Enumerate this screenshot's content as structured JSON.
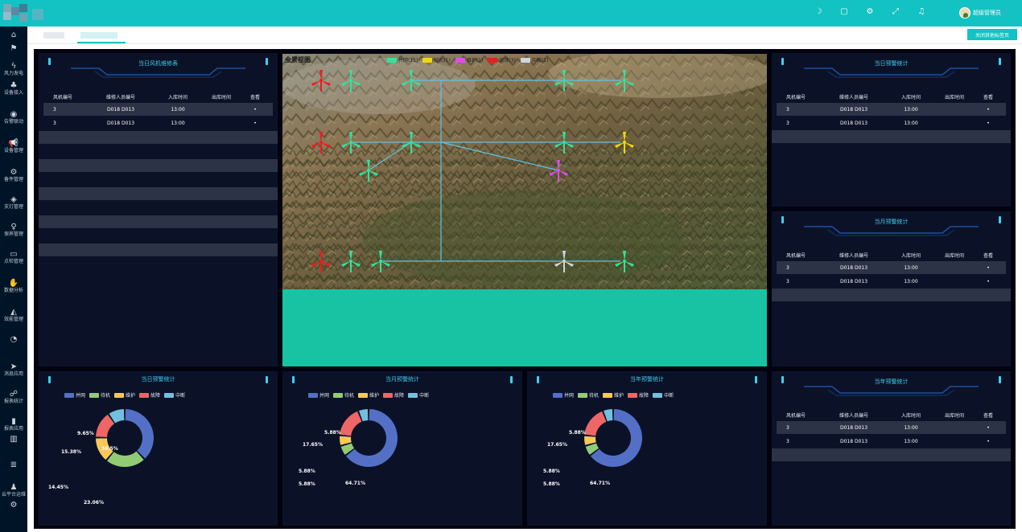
{
  "header": {
    "user_name": "超级管理员",
    "icons": [
      "moon-icon",
      "document-icon",
      "gear-icon",
      "expand-icon",
      "bell-icon"
    ]
  },
  "sidebar": {
    "items": [
      {
        "label": "",
        "icon": "home-icon"
      },
      {
        "label": "",
        "icon": "flag-icon"
      },
      {
        "label": "风力发电",
        "icon": "lightning-icon"
      },
      {
        "label": "设备接入",
        "icon": "tree-icon"
      },
      {
        "label": "告警联动",
        "icon": "chrome-icon"
      },
      {
        "label": "设备管理",
        "icon": "megaphone-icon"
      },
      {
        "label": "备件管理",
        "icon": "settings-icon"
      },
      {
        "label": "支灯管理",
        "icon": "cube-icon"
      },
      {
        "label": "保养管理",
        "icon": "bulb-icon"
      },
      {
        "label": "点检管理",
        "icon": "briefcase-icon"
      },
      {
        "label": "数据分析",
        "icon": "hand-icon"
      },
      {
        "label": "效能管理",
        "icon": "area-chart-icon"
      },
      {
        "label": "",
        "icon": "gauge-icon"
      },
      {
        "label": "消息应用",
        "icon": "send-icon"
      },
      {
        "label": "报表统计",
        "icon": "cluster-icon"
      },
      {
        "label": "报表应用",
        "icon": "bar-chart-icon"
      },
      {
        "label": "",
        "icon": "column-chart-icon"
      },
      {
        "label": "",
        "icon": "database-icon"
      },
      {
        "label": "云平台运维",
        "icon": "worker-icon"
      },
      {
        "label": "",
        "icon": "gears-icon"
      }
    ]
  },
  "tabs": {
    "close_all": "关闭其他标签页"
  },
  "colors": {
    "accent": "#13c2c2",
    "panel": "#0b1228",
    "title": "#3fc9e6",
    "online": "#2ee59d",
    "standby": "#f5d60a",
    "maintain": "#e04cf0",
    "fault": "#ee1c1c",
    "offline": "#cfd6de"
  },
  "table_headers": [
    "风机编号",
    "维修人员编号",
    "入库时间",
    "出库时间",
    "查看"
  ],
  "left_panel": {
    "title": "当日风机维修表",
    "rows": [
      {
        "id": "3",
        "staff": "D018 D013",
        "in": "13:00",
        "out": "",
        "view": "•"
      },
      {
        "id": "3",
        "staff": "D018 D013",
        "in": "13:00",
        "out": "",
        "view": "•"
      }
    ]
  },
  "map": {
    "title": "全景视图",
    "legend": [
      {
        "label": "并网(11)",
        "color": "#2ee59d"
      },
      {
        "label": "待机(1)",
        "color": "#f5d60a"
      },
      {
        "label": "维护(1)",
        "color": "#e04cf0"
      },
      {
        "label": "故障(3)",
        "color": "#ee1c1c"
      },
      {
        "label": "中断(1)",
        "color": "#cfd6de"
      }
    ]
  },
  "right_panels": [
    {
      "title": "当日预警统计",
      "rows": [
        {
          "id": "3",
          "staff": "D018 D013",
          "in": "13:00",
          "out": "",
          "view": "•"
        },
        {
          "id": "3",
          "staff": "D018 D013",
          "in": "13:00",
          "out": "",
          "view": "•"
        }
      ]
    },
    {
      "title": "当月预警统计",
      "rows": [
        {
          "id": "3",
          "staff": "D018 D013",
          "in": "13:00",
          "out": "",
          "view": "•"
        },
        {
          "id": "3",
          "staff": "D018 D013",
          "in": "13:00",
          "out": "",
          "view": "•"
        }
      ]
    },
    {
      "title": "当年预警统计",
      "rows": [
        {
          "id": "3",
          "staff": "D018 D013",
          "in": "13:00",
          "out": "",
          "view": "•"
        },
        {
          "id": "3",
          "staff": "D018 D013",
          "in": "13:00",
          "out": "",
          "view": "•"
        }
      ]
    }
  ],
  "donut_legend": [
    "并网",
    "待机",
    "维护",
    "故障",
    "中断"
  ],
  "chart_data": [
    {
      "type": "pie",
      "title": "当日预警统计",
      "categories": [
        "并网",
        "待机",
        "维护",
        "故障",
        "中断"
      ],
      "values": [
        38.5,
        23.06,
        14.45,
        15.38,
        9.65
      ],
      "labels": [
        "38.5%",
        "23.06%",
        "14.45%",
        "15.38%",
        "9.65%"
      ],
      "colors": [
        "#5470c6",
        "#91cc75",
        "#fac858",
        "#ee6666",
        "#73c0de"
      ]
    },
    {
      "type": "pie",
      "title": "当月预警统计",
      "categories": [
        "并网",
        "待机",
        "维护",
        "故障",
        "中断"
      ],
      "values": [
        64.71,
        5.88,
        5.88,
        17.65,
        5.88
      ],
      "labels": [
        "64.71%",
        "5.88%",
        "5.88%",
        "17.65%",
        "5.88%"
      ],
      "colors": [
        "#5470c6",
        "#91cc75",
        "#fac858",
        "#ee6666",
        "#73c0de"
      ]
    },
    {
      "type": "pie",
      "title": "当年预警统计",
      "categories": [
        "并网",
        "待机",
        "维护",
        "故障",
        "中断"
      ],
      "values": [
        64.71,
        5.88,
        5.88,
        17.65,
        5.88
      ],
      "labels": [
        "64.71%",
        "5.88%",
        "5.88%",
        "17.65%",
        "5.88%"
      ],
      "colors": [
        "#5470c6",
        "#91cc75",
        "#fac858",
        "#ee6666",
        "#73c0de"
      ]
    }
  ]
}
